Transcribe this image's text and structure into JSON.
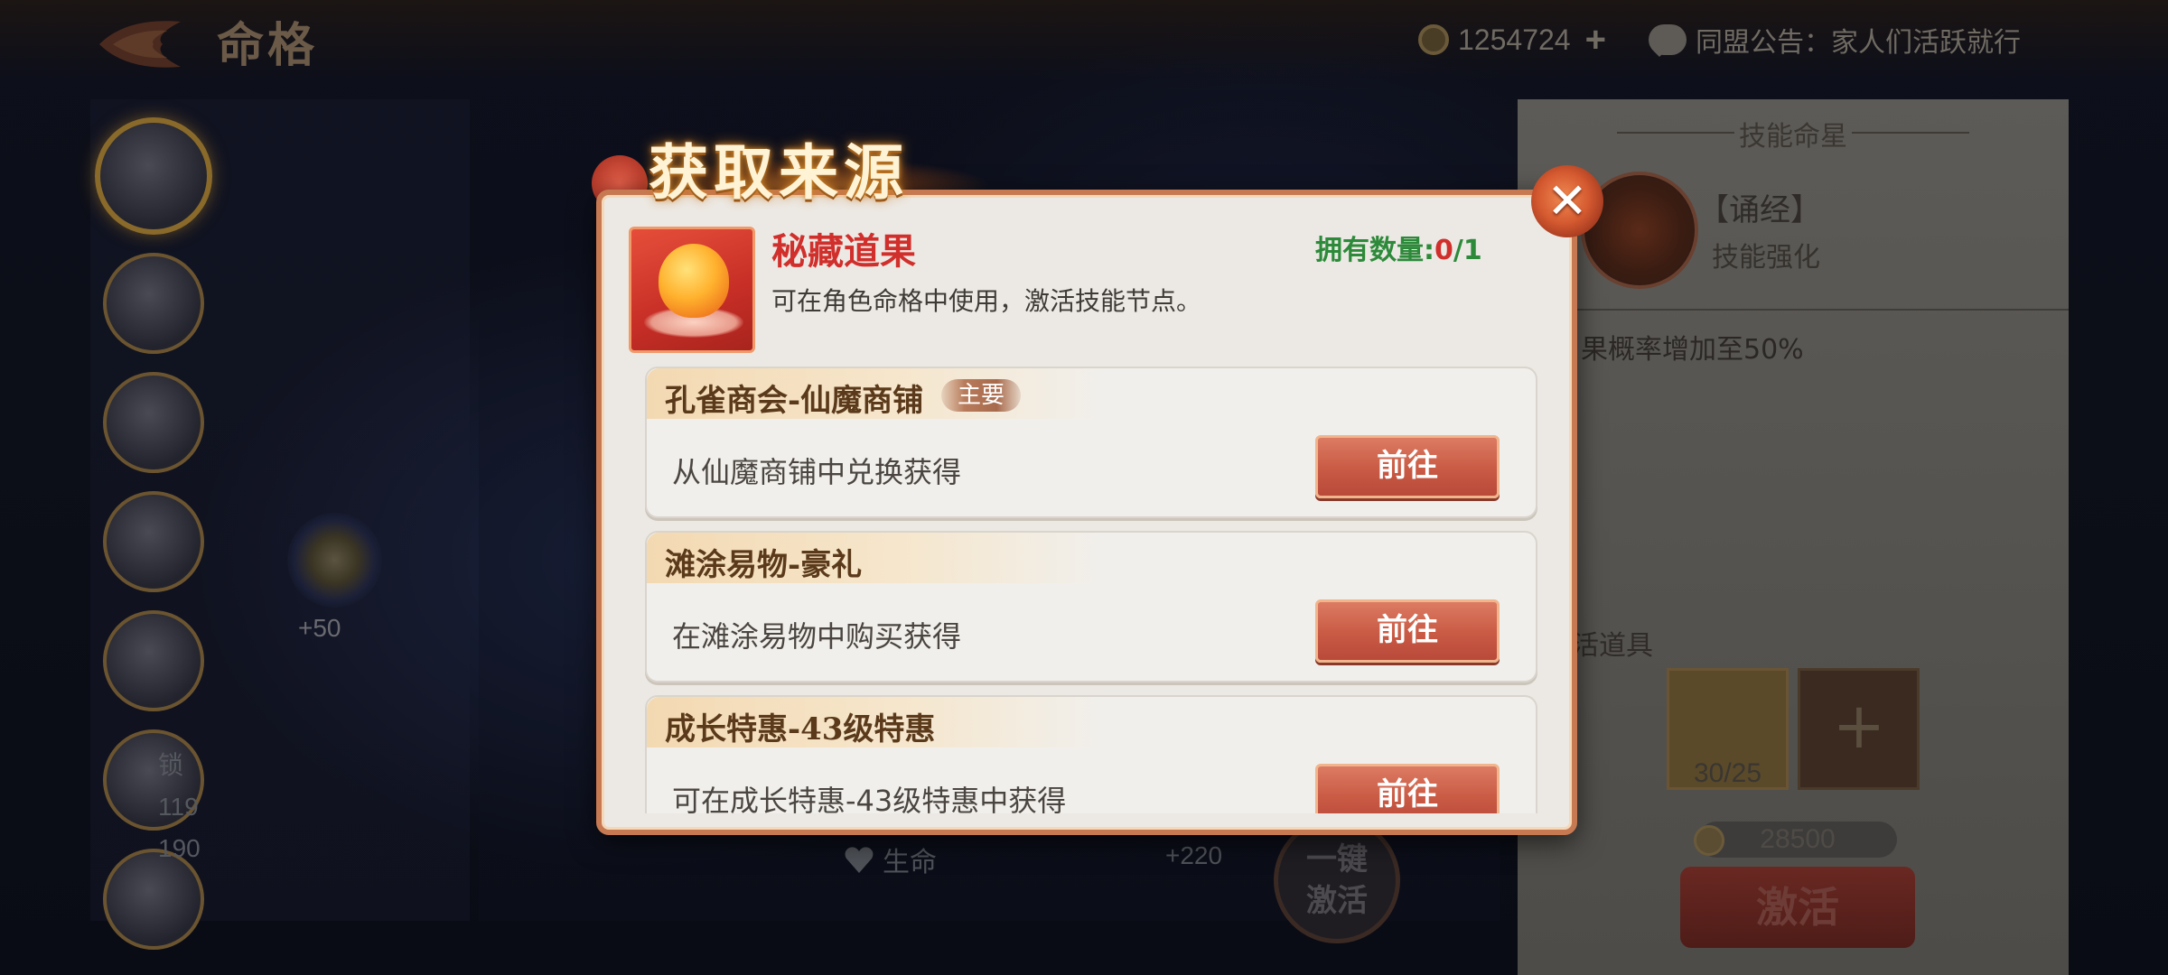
{
  "header": {
    "page_title": "命格",
    "currency_amount": "1254724",
    "currency_plus": "+",
    "notice_text": "同盟公告：家人们活跃就行"
  },
  "background": {
    "swirl_gain": "+50",
    "side_values": [
      "锁",
      "119",
      "190"
    ],
    "stat_life_label": "生命",
    "stat_gain": "+220",
    "onekey_line1": "一键",
    "onekey_line2": "激活"
  },
  "right_panel": {
    "header": "技能命星",
    "skill_name": "【诵经】",
    "skill_sub": "技能强化",
    "skill_effect": "果概率增加至50%",
    "item_title": "活道具",
    "slot_count": "30/25",
    "cost": "28500",
    "activate_label": "激活"
  },
  "modal": {
    "title": "获取来源",
    "close_symbol": "✕",
    "item": {
      "name": "秘藏道果",
      "description": "可在角色命格中使用，激活技能节点。",
      "owned_label": "拥有数量:",
      "owned_current": "0",
      "owned_total": "/1"
    },
    "sources": [
      {
        "title": "孔雀商会-仙魔商铺",
        "badge": "主要",
        "description": "从仙魔商铺中兑换获得",
        "button": "前往"
      },
      {
        "title": "滩涂易物-豪礼",
        "badge": "",
        "description": "在滩涂易物中购买获得",
        "button": "前往"
      },
      {
        "title": "成长特惠-43级特惠",
        "badge": "",
        "description": "可在成长特惠-43级特惠中获得",
        "button": "前往"
      }
    ]
  },
  "colors": {
    "accent_red": "#d12f2c",
    "owned_green": "#2d8a3a",
    "button_orange": "#c95a44",
    "modal_border": "#c77a52"
  }
}
